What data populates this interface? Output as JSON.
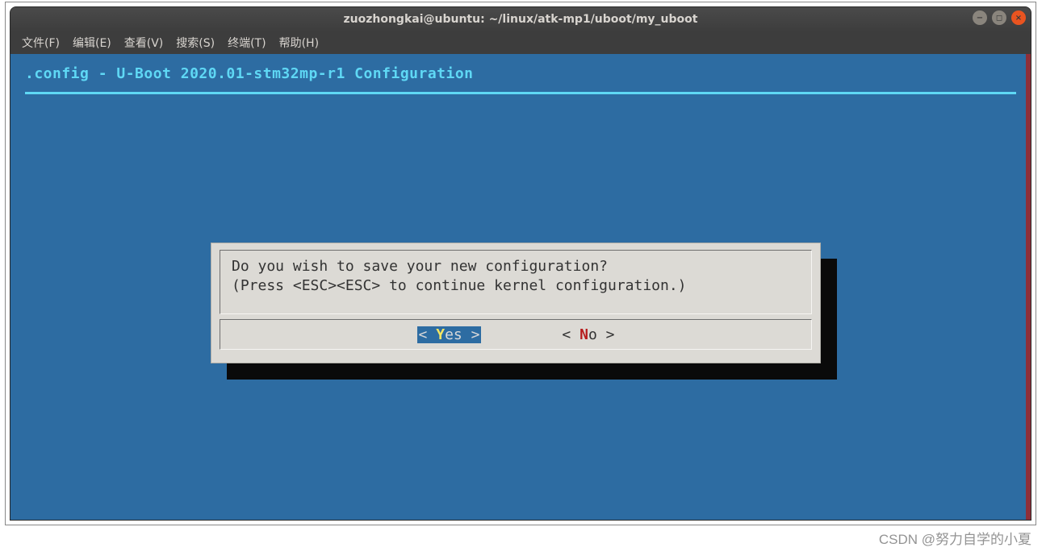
{
  "window": {
    "title": "zuozhongkai@ubuntu: ~/linux/atk-mp1/uboot/my_uboot"
  },
  "menubar": {
    "file": "文件(F)",
    "edit": "编辑(E)",
    "view": "查看(V)",
    "search": "搜索(S)",
    "terminal": "终端(T)",
    "help": "帮助(H)"
  },
  "config": {
    "title": ".config - U-Boot 2020.01-stm32mp-r1 Configuration"
  },
  "dialog": {
    "line1": "Do you wish to save your new configuration?",
    "line2": "(Press <ESC><ESC> to continue kernel configuration.)",
    "yes_prefix": "< ",
    "yes_hot": "Y",
    "yes_rest": "es >",
    "no_prefix": "<  ",
    "no_hot": "N",
    "no_rest": "o  >"
  },
  "watermark": "CSDN @努力自学的小夏"
}
